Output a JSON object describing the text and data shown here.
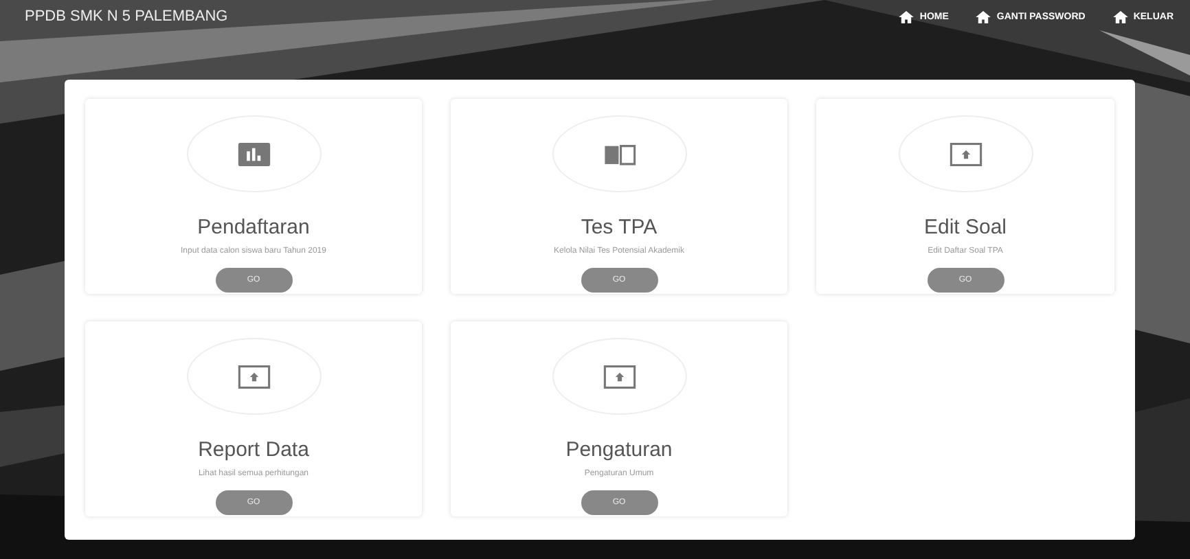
{
  "navbar": {
    "brand": "PPDB SMK N 5 PALEMBANG",
    "links": [
      {
        "label": "HOME"
      },
      {
        "label": "GANTI PASSWORD"
      },
      {
        "label": "KELUAR"
      }
    ]
  },
  "cards": [
    {
      "kind": "chart",
      "title": "Pendaftaran",
      "description": "Input data calon siswa baru Tahun 2019",
      "button": "GO"
    },
    {
      "kind": "book",
      "title": "Tes TPA",
      "description": "Kelola Nilai Tes Potensial Akademik",
      "button": "GO"
    },
    {
      "kind": "upload",
      "title": "Edit Soal",
      "description": "Edit Daftar Soal TPA",
      "button": "GO"
    },
    {
      "kind": "upload",
      "title": "Report Data",
      "description": "Lihat hasil semua perhitungan",
      "button": "GO"
    },
    {
      "kind": "upload",
      "title": "Pengaturan",
      "description": "Pengaturan Umum",
      "button": "GO"
    }
  ]
}
